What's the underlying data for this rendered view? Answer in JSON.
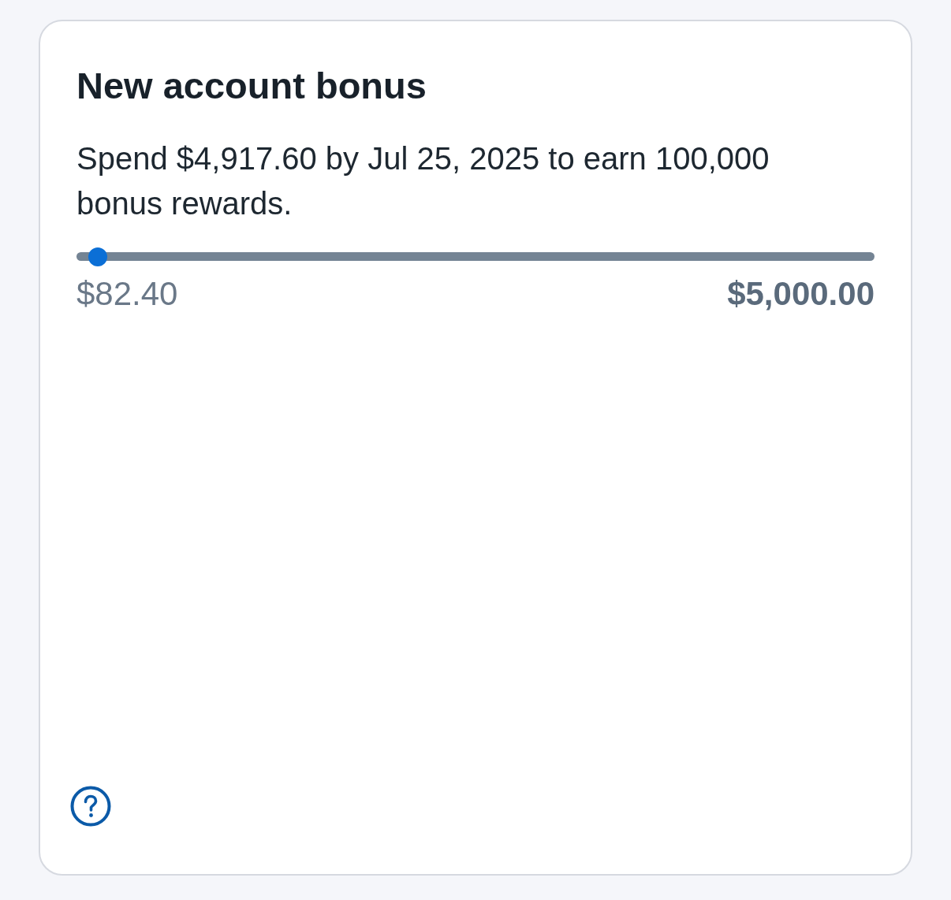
{
  "card": {
    "title": "New account bonus",
    "description": "Spend $4,917.60 by Jul 25, 2025 to earn 100,000 bonus rewards.",
    "progress": {
      "level": 0.016,
      "start_label": "$82.40",
      "end_label": "$5,000.00"
    }
  }
}
